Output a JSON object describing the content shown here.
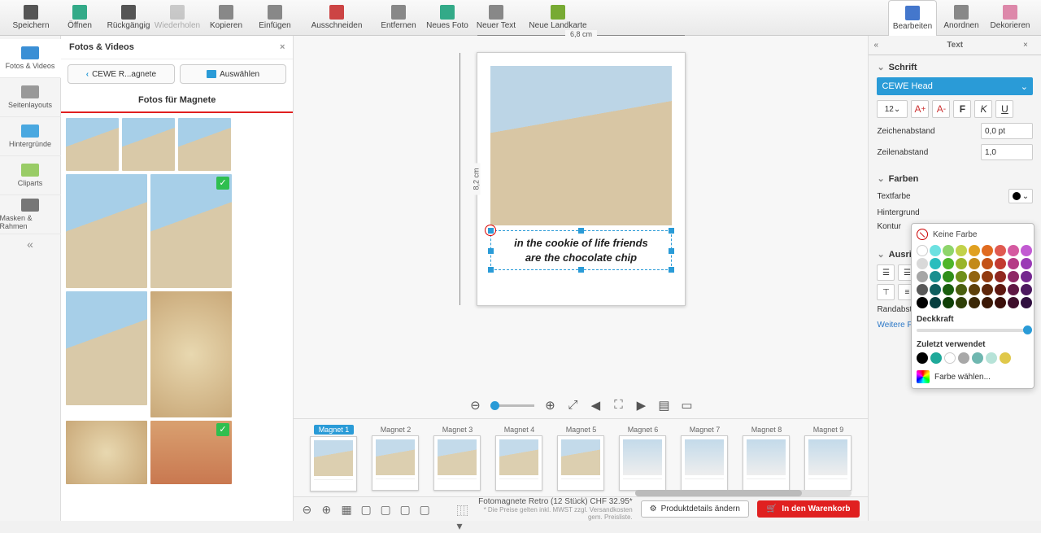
{
  "toolbar": {
    "left": [
      "Speichern",
      "Öffnen",
      "Rückgängig",
      "Wiederholen",
      "Kopieren",
      "Einfügen",
      "Ausschneiden",
      "Entfernen",
      "Neues Foto",
      "Neuer Text",
      "Neue Landkarte"
    ],
    "right": [
      "Bearbeiten",
      "Anordnen",
      "Dekorieren"
    ]
  },
  "rail": [
    "Fotos & Videos",
    "Seitenlayouts",
    "Hintergründe",
    "Cliparts",
    "Masken & Rahmen"
  ],
  "gallery": {
    "heading": "Fotos & Videos",
    "back": "CEWE R...agnete",
    "select": "Auswählen",
    "title": "Fotos für Magnete"
  },
  "canvas": {
    "dim_w": "6,8 cm",
    "dim_h": "8,2 cm",
    "text_l1": "in the cookie of life friends",
    "text_l2": "are the chocolate chip"
  },
  "magnets": [
    "Magnet 1",
    "Magnet 2",
    "Magnet 3",
    "Magnet 4",
    "Magnet 5",
    "Magnet 6",
    "Magnet 7",
    "Magnet 8",
    "Magnet 9"
  ],
  "footer": {
    "product": "Fotomagnete Retro (12 Stück) CHF 32.95*",
    "fine": "* Die Preise gelten inkl. MWST zzgl. Versandkosten gem. Preisliste.",
    "details": "Produktdetails ändern",
    "cart": "In den Warenkorb"
  },
  "panel": {
    "tab": "Text",
    "font_sec": "Schrift",
    "font": "CEWE Head",
    "size": "12",
    "char_spacing_l": "Zeichenabstand",
    "char_spacing_v": "0,0 pt",
    "line_spacing_l": "Zeilenabstand",
    "line_spacing_v": "1,0",
    "colors_sec": "Farben",
    "textcolor": "Textfarbe",
    "bgcolor": "Hintergrund",
    "outline": "Kontur",
    "align_sec": "Ausrichtung",
    "margin": "Randabstand",
    "more": "Weitere Funk"
  },
  "colorpop": {
    "none": "Keine Farbe",
    "opacity": "Deckkraft",
    "recent": "Zuletzt verwendet",
    "pick": "Farbe wählen...",
    "grid": [
      "#fff",
      "#6de1e1",
      "#8ed56b",
      "#c2d24b",
      "#e0a020",
      "#e06b20",
      "#e05a50",
      "#d55aa0",
      "#c25ad2",
      "#d9d9d9",
      "#2abdbd",
      "#4fb52a",
      "#9ab52a",
      "#c38a18",
      "#c35218",
      "#c33a30",
      "#b53a85",
      "#9a3ab5",
      "#a6a6a6",
      "#1a8f8f",
      "#2f8f1a",
      "#6f8f1a",
      "#916410",
      "#913a10",
      "#912820",
      "#8f2865",
      "#75288f",
      "#595959",
      "#0f5f5f",
      "#1a5f0f",
      "#4a5f0f",
      "#5e400a",
      "#5e260a",
      "#5e1810",
      "#5f1843",
      "#4c185f",
      "#000",
      "#073f3f",
      "#0f3f07",
      "#2f3f07",
      "#3b2806",
      "#3b1806",
      "#3b0f0a",
      "#3f0f2b",
      "#300f3f"
    ],
    "recent_colors": [
      "#000",
      "#1fa99a",
      "#fff",
      "#a8a8a8",
      "#6fb7b0",
      "#b7e3d8",
      "#e0c84a"
    ]
  }
}
